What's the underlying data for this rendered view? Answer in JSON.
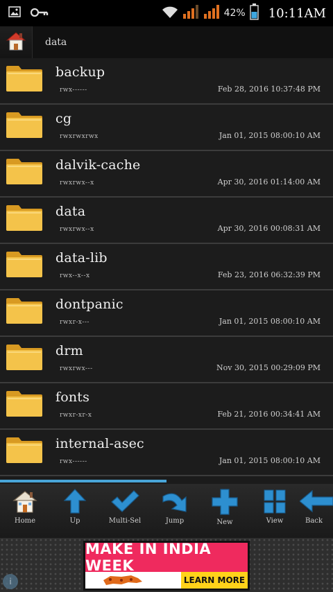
{
  "status_bar": {
    "battery_percent": "42%",
    "time": "10:11AM",
    "icons": [
      "image-icon",
      "key-icon",
      "wifi-icon",
      "signal-icon",
      "signal-icon",
      "battery-icon"
    ]
  },
  "breadcrumb": {
    "path": [
      "data"
    ]
  },
  "files": [
    {
      "name": "backup",
      "perms": "rwx------",
      "date": "Feb 28, 2016 10:37:48 PM"
    },
    {
      "name": "cg",
      "perms": "rwxrwxrwx",
      "date": "Jan 01, 2015 08:00:10 AM"
    },
    {
      "name": "dalvik-cache",
      "perms": "rwxrwx--x",
      "date": "Apr 30, 2016 01:14:00 AM"
    },
    {
      "name": "data",
      "perms": "rwxrwx--x",
      "date": "Apr 30, 2016 00:08:31 AM"
    },
    {
      "name": "data-lib",
      "perms": "rwx--x--x",
      "date": "Feb 23, 2016 06:32:39 PM"
    },
    {
      "name": "dontpanic",
      "perms": "rwxr-x---",
      "date": "Jan 01, 2015 08:00:10 AM"
    },
    {
      "name": "drm",
      "perms": "rwxrwx---",
      "date": "Nov 30, 2015 00:29:09 PM"
    },
    {
      "name": "fonts",
      "perms": "rwxr-xr-x",
      "date": "Feb 21, 2016 00:34:41 AM"
    },
    {
      "name": "internal-asec",
      "perms": "rwx------",
      "date": "Jan 01, 2015 08:00:10 AM"
    }
  ],
  "list_scroll_fraction": 0.5,
  "toolbar": {
    "home": "Home",
    "up": "Up",
    "multi_sel": "Multi-Sel",
    "jump": "Jump",
    "new": "New",
    "view": "View",
    "back": "Back"
  },
  "ad": {
    "headline": "MAKE IN INDIA WEEK",
    "cta": "LEARN MORE",
    "colors": {
      "headline_bg": "#ef2a5e",
      "cta_bg": "#ffd21a"
    }
  },
  "colors": {
    "folder": "#f2bf3c",
    "accent": "#49a5d8"
  }
}
